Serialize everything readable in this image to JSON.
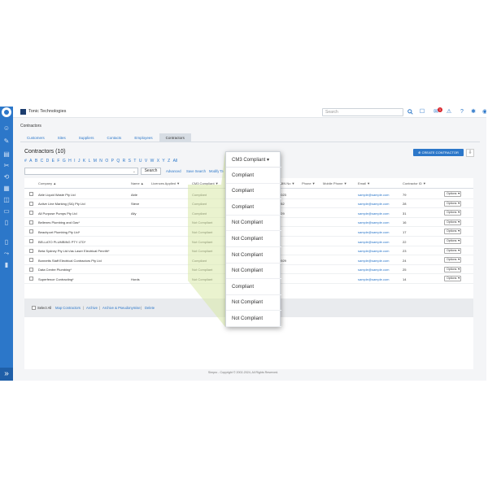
{
  "app": {
    "brand": "Tonic Technologies",
    "search_placeholder": "Search",
    "notification_count": "1",
    "expand_icon": "»",
    "copyright": "Simpro - Copyright © 2002-2024, All Rights Reserved."
  },
  "page": {
    "breadcrumb": "Contractors",
    "title": "Contractors (10)",
    "create_label": "CREATE CONTRACTOR",
    "tabs": [
      "Customers",
      "Sites",
      "Suppliers",
      "Contacts",
      "Employees",
      "Contractors"
    ],
    "active_tab": "Contractors",
    "alphabet": [
      "#",
      "A",
      "B",
      "C",
      "D",
      "E",
      "F",
      "G",
      "H",
      "I",
      "J",
      "K",
      "L",
      "M",
      "N",
      "O",
      "P",
      "Q",
      "R",
      "S",
      "T",
      "U",
      "V",
      "W",
      "X",
      "Y",
      "Z",
      "All"
    ],
    "search_button": "Search",
    "advanced": "Advanced",
    "save_search": "Save Search",
    "modify": "Modify Ta"
  },
  "table": {
    "headers": {
      "company": "Company ▲",
      "name": "Name ▲",
      "licences": "Licences Applied ▼",
      "cm3": "CM3 Compliant ▼",
      "mobile": "Mobile Phone ▼",
      "email": "Email ▼",
      "phone": "Phone ▼",
      "abn": "ABN No ▼",
      "id": "Contractor ID ▼"
    },
    "rows": [
      {
        "company": "Able Liquid Waste Pty Ltd",
        "name": "Able",
        "cm3": "Compliant",
        "abn": "2023",
        "email": "sample@sample.com",
        "id": "79",
        "options": "Options ▼"
      },
      {
        "company": "Active Line Marking (SA) Pty Ltd",
        "name": "Steve",
        "cm3": "Compliant",
        "abn": "052",
        "email": "sample@sample.com",
        "id": "28",
        "options": "Options ▼"
      },
      {
        "company": "All Purpose Pumps Pty Ltd",
        "name": "Ally",
        "cm3": "Compliant",
        "abn": "529",
        "email": "sample@sample.com",
        "id": "31",
        "options": "Options ▼"
      },
      {
        "company": "Bellenes Plumbing and Gas*",
        "name": "",
        "cm3": "Not Compliant",
        "abn": "",
        "email": "sample@sample.com",
        "id": "16",
        "options": "Options ▼"
      },
      {
        "company": "Beachport Plumbing Pty Ltd*",
        "name": "",
        "cm3": "Not Compliant",
        "abn": "",
        "email": "sample@sample.com",
        "id": "17",
        "options": "Options ▼"
      },
      {
        "company": "BELLATO PLUMBING PTY LTD*",
        "name": "",
        "cm3": "Not Compliant",
        "abn": "",
        "email": "sample@sample.com",
        "id": "22",
        "options": "Options ▼"
      },
      {
        "company": "Beta Sydney Pty Ltd t/as Laser Electrical Penrith*",
        "name": "",
        "cm3": "Not Compliant",
        "abn": "",
        "email": "sample@sample.com",
        "id": "23",
        "options": "Options ▼"
      },
      {
        "company": "Bonnetts Staff Electrical Contractors Pty Ltd",
        "name": "",
        "cm3": "Compliant",
        "abn": "0929",
        "email": "sample@sample.com",
        "id": "24",
        "options": "Options ▼"
      },
      {
        "company": "Data Centre Plumbing*",
        "name": "",
        "cm3": "Not Compliant",
        "abn": "",
        "email": "sample@sample.com",
        "id": "25",
        "options": "Options ▼"
      },
      {
        "company": "Superfence Contracting*",
        "name": "Hords",
        "cm3": "Not Compliant",
        "abn": "",
        "email": "sample@sample.com",
        "id": "14",
        "options": "Options ▼"
      }
    ],
    "footer": {
      "select_all": "Select All",
      "actions": [
        "Map Contractors",
        "Archive",
        "Archive & Pseudonymise",
        "Delete"
      ],
      "separator": "|"
    }
  },
  "dropdown": {
    "header": "CM3 Compliant",
    "chevron": "▾",
    "items": [
      "Compliant",
      "Compliant",
      "Compliant",
      "Not Compliant",
      "Not Compliant",
      "Not Compliant",
      "Not Compliant",
      "Compliant",
      "Not Compliant",
      "Not Compliant"
    ]
  },
  "colors": {
    "accent": "#2c77c9",
    "highlight": "#d8eaa8"
  }
}
